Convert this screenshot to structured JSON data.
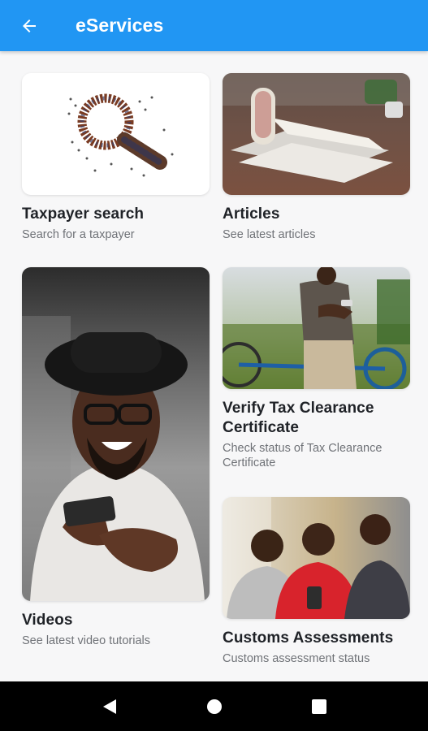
{
  "appbar": {
    "title": "eServices",
    "color": "#2196f3",
    "back_icon": "arrow-left-icon"
  },
  "cards": {
    "taxpayer_search": {
      "title": "Taxpayer search",
      "subtitle": "Search for a taxpayer",
      "image": "crowd-magnifier-image"
    },
    "articles": {
      "title": "Articles",
      "subtitle": "See latest articles",
      "image": "magazines-on-table-image"
    },
    "videos": {
      "title": "Videos",
      "subtitle": "See latest video tutorials",
      "image": "man-with-phone-image"
    },
    "verify_tcc": {
      "title": "Verify Tax Clearance Certificate",
      "subtitle": "Check status of Tax Clearance Certificate",
      "image": "man-on-bicycle-image"
    },
    "customs": {
      "title": "Customs Assessments",
      "subtitle": "Customs assessment status",
      "image": "women-with-phone-image"
    }
  },
  "navbar": {
    "back": "nav-back-icon",
    "home": "nav-home-icon",
    "recents": "nav-recents-icon"
  }
}
